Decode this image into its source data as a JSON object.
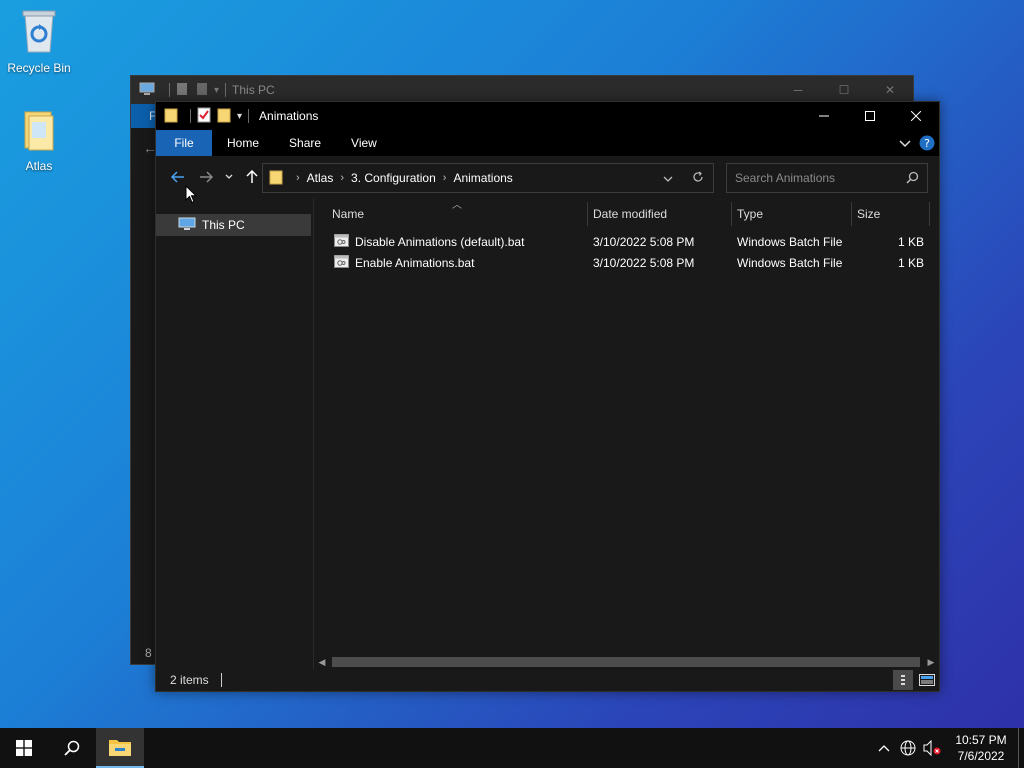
{
  "desktop": {
    "recycle_bin_label": "Recycle Bin",
    "atlas_label": "Atlas"
  },
  "back_window": {
    "title": "This PC",
    "ribbon_letter": "F",
    "side_letter": "8 i"
  },
  "window": {
    "title": "Animations",
    "tabs": [
      "File",
      "Home",
      "Share",
      "View"
    ],
    "breadcrumb": [
      "Atlas",
      "3. Configuration",
      "Animations"
    ],
    "search_placeholder": "Search Animations",
    "nav_items": [
      "This PC"
    ],
    "columns": {
      "name": "Name",
      "date": "Date modified",
      "type": "Type",
      "size": "Size"
    },
    "files": [
      {
        "name": "Disable Animations (default).bat",
        "date": "3/10/2022 5:08 PM",
        "type": "Windows Batch File",
        "size": "1 KB"
      },
      {
        "name": "Enable Animations.bat",
        "date": "3/10/2022 5:08 PM",
        "type": "Windows Batch File",
        "size": "1 KB"
      }
    ],
    "status": "2 items"
  },
  "taskbar": {
    "time": "10:57 PM",
    "date": "7/6/2022"
  },
  "colors": {
    "accent": "#1964b4",
    "back_arrow": "#4aa3f0",
    "folder": "#f7d774"
  }
}
